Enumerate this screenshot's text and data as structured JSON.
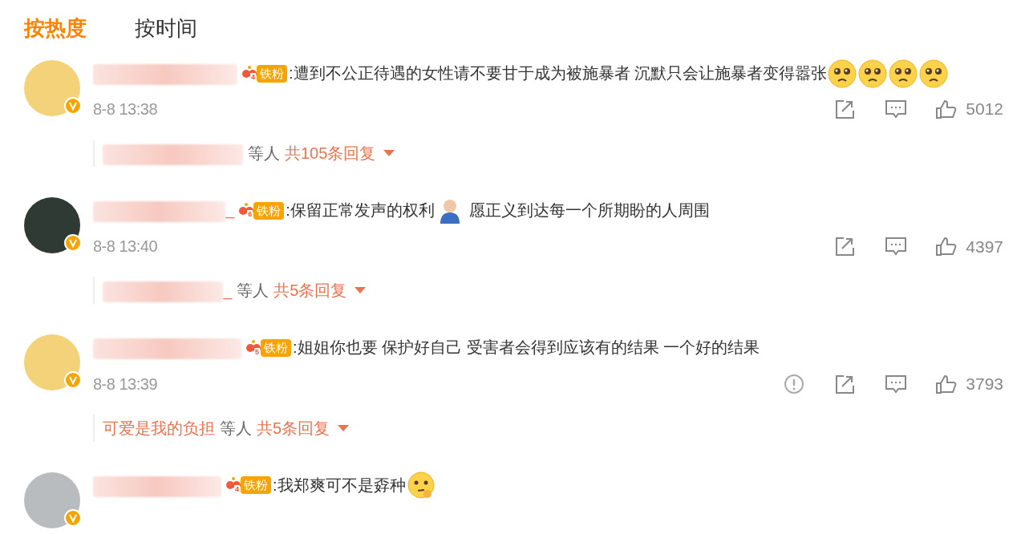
{
  "tabs": [
    {
      "label": "按热度",
      "selected": true
    },
    {
      "label": "按时间",
      "selected": false
    }
  ],
  "comments": [
    {
      "avatar": {
        "color": "#f3d27a"
      },
      "fan_badge": {
        "level": "4",
        "label": "铁粉"
      },
      "content": [
        {
          "kind": "text",
          "text": ":遭到不公正待遇的女性请不要甘于成为被施暴者 沉默只会让施暴者变得嚣张"
        },
        {
          "kind": "crying-emoji"
        },
        {
          "kind": "crying-emoji"
        },
        {
          "kind": "crying-emoji"
        },
        {
          "kind": "crying-emoji"
        }
      ],
      "time": "8-8 13:38",
      "actions": [
        {
          "kind": "share"
        },
        {
          "kind": "comment"
        },
        {
          "kind": "like",
          "count": "5012"
        }
      ],
      "replies": {
        "others": "等人",
        "total": "共105条回复"
      }
    },
    {
      "avatar": {
        "color": "#2f3a35"
      },
      "name_suffix": "_",
      "fan_badge": {
        "level": "6",
        "label": "铁粉"
      },
      "content": [
        {
          "kind": "text",
          "text": ":保留正常发声的权利"
        },
        {
          "kind": "person-emoji"
        },
        {
          "kind": "text",
          "text": " 愿正义到达每一个所期盼的人周围"
        }
      ],
      "time": "8-8 13:40",
      "actions": [
        {
          "kind": "share"
        },
        {
          "kind": "comment"
        },
        {
          "kind": "like",
          "count": "4397"
        }
      ],
      "replies": {
        "name_suffix": "_",
        "others": "等人",
        "total": "共5条回复"
      }
    },
    {
      "avatar": {
        "color": "#f3d27a"
      },
      "fan_badge": {
        "level": "5",
        "label": "铁粉"
      },
      "content": [
        {
          "kind": "text",
          "text": ":姐姐你也要 保护好自己 受害者会得到应该有的结果 一个好的结果"
        }
      ],
      "time": "8-8 13:39",
      "actions": [
        {
          "kind": "report"
        },
        {
          "kind": "share"
        },
        {
          "kind": "comment"
        },
        {
          "kind": "like",
          "count": "3793"
        }
      ],
      "replies": {
        "name": "可爱是我的负担",
        "others": "等人",
        "total": "共5条回复"
      }
    },
    {
      "avatar": {
        "color": "#b8bcbf"
      },
      "fan_badge": {
        "level": "4",
        "label": "铁粉"
      },
      "content": [
        {
          "kind": "text",
          "text": ":我郑爽可不是孬种"
        },
        {
          "kind": "thinking-emoji"
        }
      ]
    }
  ]
}
